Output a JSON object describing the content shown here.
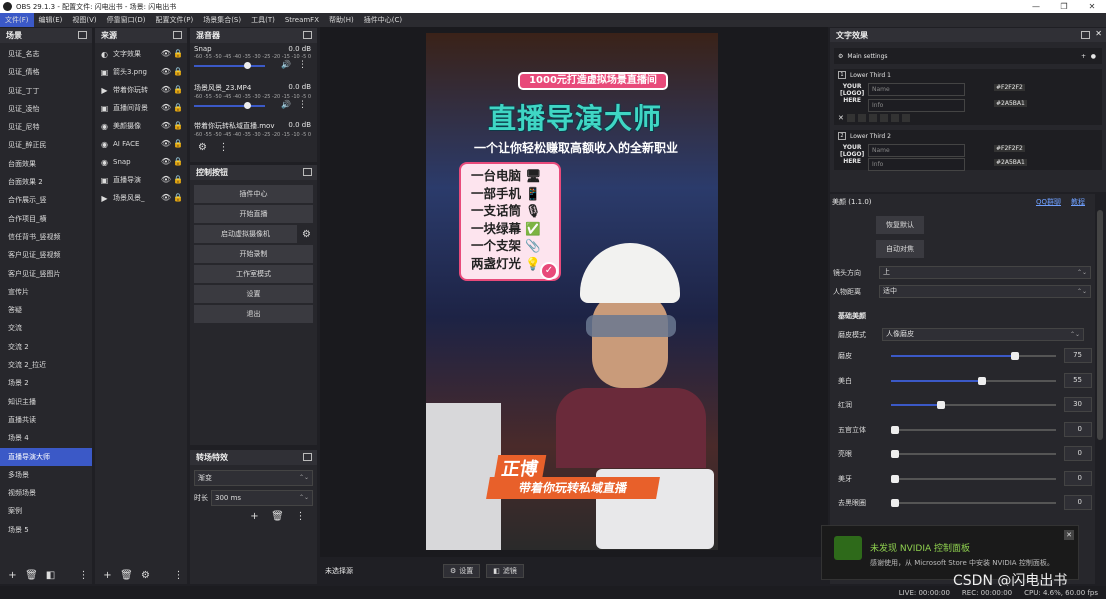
{
  "window": {
    "title": "OBS 29.1.3 - 配置文件: 闪电出书 - 场景: 闪电出书"
  },
  "menu": [
    "文件(F)",
    "编辑(E)",
    "视图(V)",
    "停靠窗口(D)",
    "配置文件(P)",
    "场景集合(S)",
    "工具(T)",
    "StreamFX",
    "帮助(H)",
    "插件中心(C)"
  ],
  "scenes": {
    "title": "场景",
    "items": [
      "见证_名志",
      "见证_倩格",
      "见证_丁丁",
      "见证_凌怡",
      "见证_尼特",
      "见证_醉正民",
      "台面效果",
      "台面效果 2",
      "合作展示_竖",
      "合作项目_横",
      "信任背书_竖视频",
      "客户见证_竖视频",
      "客户见证_竖图片",
      "宣传片",
      "答疑",
      "交流",
      "交流 2",
      "交流 2_拉近",
      "场景 2",
      "知识主播",
      "直播共读",
      "场景 4",
      "直播导演大师",
      "多场景",
      "视频场景",
      "案例",
      "场景 5"
    ],
    "selected": 22
  },
  "sources": {
    "title": "来源",
    "items": [
      {
        "name": "文字效果",
        "icon": "filter-icon"
      },
      {
        "name": "箭头3.png",
        "icon": "image-icon"
      },
      {
        "name": "带着你玩转",
        "icon": "play-icon"
      },
      {
        "name": "直播间背景",
        "icon": "image-icon"
      },
      {
        "name": "美颜摄像",
        "icon": "camera-icon"
      },
      {
        "name": "AI FACE",
        "icon": "camera-icon"
      },
      {
        "name": "Snap",
        "icon": "camera-icon"
      },
      {
        "name": "直播导演",
        "icon": "image-icon"
      },
      {
        "name": "场景风景_",
        "icon": "play-icon"
      }
    ]
  },
  "mixer": {
    "title": "混音器",
    "channels": [
      {
        "name": "Snap",
        "db": "0.0 dB",
        "level": 0.78
      },
      {
        "name": "场景风景_23.MP4",
        "db": "0.0 dB",
        "level": 0.78
      },
      {
        "name": "带着你玩转私域直播.mov",
        "db": "0.0 dB",
        "level": 0.78
      }
    ],
    "ticks": "-60 -55 -50 -45 -40 -35 -30 -25 -20 -15 -10 -5 0"
  },
  "controls": {
    "title": "控制按钮",
    "buttons": [
      "插件中心",
      "开始直播",
      "启动虚拟摄像机",
      "开始录制",
      "工作室模式",
      "设置",
      "退出"
    ]
  },
  "transitions": {
    "title": "转场特效",
    "type": "渐变",
    "duration_label": "时长",
    "duration": "300 ms"
  },
  "canvas": {
    "badge": "1000元打造虚拟场景直播间",
    "title": "直播导演大师",
    "subtitle": "一个让你轻松赚取高额收入的全新职业",
    "list": [
      "一台电脑 🖥",
      "一部手机 📱",
      "一支话筒 🎙",
      "一块绿幕 ✅",
      "一个支架 📎",
      "两盏灯光 💡"
    ],
    "banner_title": "正博",
    "banner_text": "带着你玩转私域直播"
  },
  "preview_bar": {
    "transition_label": "未选择源",
    "settings": "设置",
    "filters": "滤镜"
  },
  "text_effects": {
    "title": "文字效果",
    "main": "Main settings",
    "lt1": "Lower Third 1",
    "lt2": "Lower Third 2",
    "logo_lines": [
      "YOUR",
      "[LOGO]",
      "HERE"
    ],
    "name_ph": "Name",
    "info_ph": "Info",
    "color1": "#F2F2F2",
    "color2": "#2A5BA1"
  },
  "beauty": {
    "title": "美颜 (1.1.0)",
    "qq": "QQ群聊",
    "tutorial": "教程",
    "reset": "恢复默认",
    "auto": "自动对焦",
    "direction_label": "镜头方向",
    "direction": "上",
    "distance_label": "人物距离",
    "distance": "适中",
    "basic": "基础美颜",
    "mode_label": "磨皮模式",
    "mode": "人像磨皮",
    "sliders": [
      {
        "label": "磨皮",
        "value": "75",
        "pct": 0.75
      },
      {
        "label": "美白",
        "value": "55",
        "pct": 0.55
      },
      {
        "label": "红润",
        "value": "30",
        "pct": 0.3
      },
      {
        "label": "五官立体",
        "value": "0",
        "pct": 0.0
      },
      {
        "label": "亮眼",
        "value": "0",
        "pct": 0.0
      },
      {
        "label": "美牙",
        "value": "0",
        "pct": 0.0
      },
      {
        "label": "去黑眼圈",
        "value": "0",
        "pct": 0.0
      }
    ]
  },
  "notify": {
    "title": "未发现 NVIDIA 控制面板",
    "body": "感谢使用，从 Microsoft Store 中安装 NVIDIA 控制面板。"
  },
  "status": {
    "live": "LIVE: 00:00:00",
    "rec": "REC: 00:00:00",
    "cpu": "CPU: 4.6%, 60.00 fps"
  },
  "watermark": "CSDN @闪电出书",
  "colors": {
    "accent": "#3b59c7",
    "panel": "#27272c",
    "badge": "#e84a7a",
    "title_teal": "#3fd6c4"
  }
}
